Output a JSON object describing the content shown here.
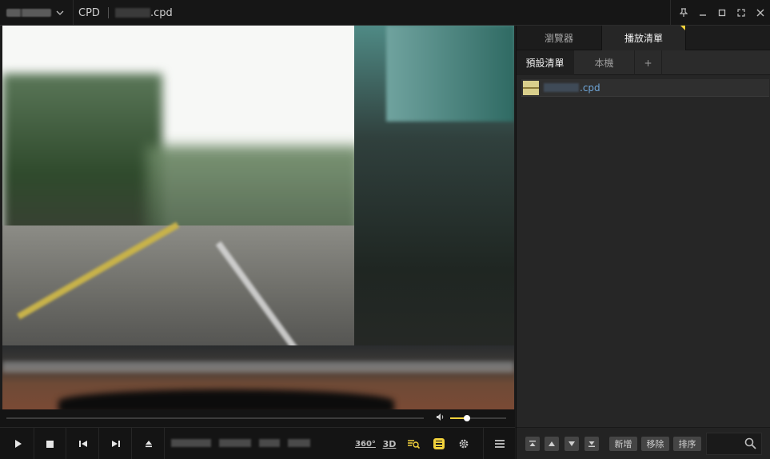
{
  "window": {
    "file_ext": ".cpd",
    "file_prefix": "CPD",
    "controls": {
      "pin": "pin-icon",
      "minimize": "minimize-icon",
      "maximize": "maximize-icon",
      "fullscreen": "fullscreen-icon",
      "close": "close-icon"
    }
  },
  "player": {
    "volume_level_percent": 30,
    "features": {
      "vr": "360°",
      "threed": "3D"
    },
    "icons": [
      "play-icon",
      "stop-icon",
      "previous-icon",
      "next-icon",
      "eject-icon",
      "search-subtitle-icon",
      "subtitle-icon",
      "gear-icon",
      "menu-icon"
    ]
  },
  "panel": {
    "tabs": [
      {
        "label": "瀏覽器",
        "active": false
      },
      {
        "label": "播放清單",
        "active": true
      }
    ],
    "sub_tabs": [
      {
        "label": "預設清單",
        "active": true
      },
      {
        "label": "本機",
        "active": false
      },
      {
        "label": "+",
        "active": false
      }
    ],
    "playlist": [
      {
        "name_suffix": ".cpd"
      }
    ],
    "bottom": {
      "add_label": "新增",
      "remove_label": "移除",
      "sort_label": "排序"
    }
  },
  "colors": {
    "accent": "#f2d23c",
    "link": "#6fa6d8",
    "background": "#1c1c1c"
  }
}
